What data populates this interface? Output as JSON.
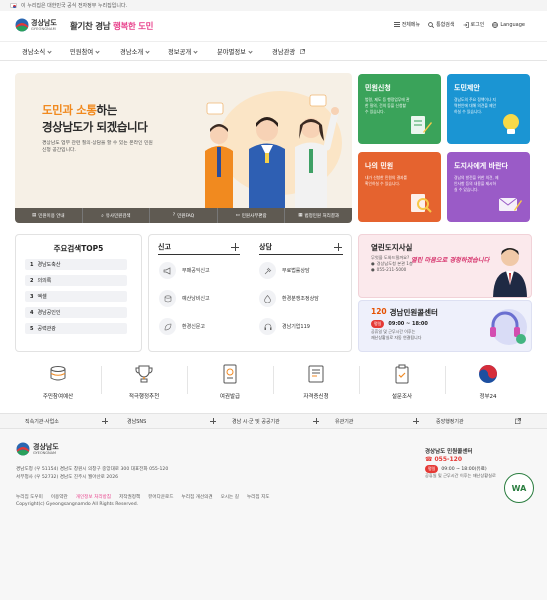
{
  "topbar": {
    "notice": "이 누리집은 대한민국 공식 전자정부 누리집입니다."
  },
  "header": {
    "logo_ko": "경상남도",
    "logo_en": "GYEONGNAM",
    "slogan_a": "활기찬 경남",
    "slogan_b": "행복한 도민",
    "links": {
      "all_menu": "전체메뉴",
      "search": "통합검색",
      "login": "로그인",
      "language": "Language"
    }
  },
  "nav": [
    "경남소식",
    "민원참여",
    "경남소개",
    "정보공개",
    "분야별정보",
    "경남관광"
  ],
  "hero": {
    "title_hl": "도민과 소통",
    "title_rest": "하는",
    "title2": "경상남도가 되겠습니다",
    "desc": "경상남도 업무 관련 질의·상담을 할 수 있는 온라인 민원신청 공간입니다.",
    "bar": [
      "민원이용 안내",
      "유사민원검색",
      "민원FAQ",
      "민원사무편람",
      "법정민원 처리결과"
    ]
  },
  "tiles": [
    {
      "title": "민원신청",
      "desc": "법령, 제도 등 행정업무에 관한 질의, 건의 등을 신청할 수 있습니다.",
      "color": "#3aa35a"
    },
    {
      "title": "도민제안",
      "desc": "경남도의 주요 정책이나 지역현안에 대해 의견을 제안하실 수 있습니다.",
      "color": "#1b95d3"
    },
    {
      "title": "나의 민원",
      "desc": "내가 신청한 민원의 결과를 확인하실 수 있습니다.",
      "color": "#e5632f"
    },
    {
      "title": "도지사에게 바란다",
      "desc": "경남의 발전을 위한 의견, 제안사항 등의 내용을 제시하실 수 있습니다.",
      "color": "#9a5bc7"
    }
  ],
  "keywords": {
    "title": "주요검색TOP5",
    "items": [
      {
        "rank": "1",
        "text": "경남도축산"
      },
      {
        "rank": "2",
        "text": "의의록"
      },
      {
        "rank": "3",
        "text": "엑셀"
      },
      {
        "rank": "4",
        "text": "경남공인인"
      },
      {
        "rank": "5",
        "text": "공력관광"
      }
    ]
  },
  "report": {
    "title": "신고",
    "items": [
      "부패공익신고",
      "예산낭비신고",
      "환경신문고"
    ]
  },
  "consult": {
    "title": "상담",
    "items": [
      "무료법률상담",
      "환경분쟁조정상담",
      "경남기업119"
    ]
  },
  "governor": {
    "title": "열린도지사실",
    "sub1": "무엇을 도와드릴까요?",
    "sub2": "경상남도청 본관 1층",
    "phone": "055-211-5000",
    "slogan": "열린 마음으로 경청하겠습니다"
  },
  "callcenter": {
    "title_num": "120",
    "title": "경남민원콜센터",
    "badge": "평일",
    "hours": "09:00 ~ 18:00",
    "note1": "공휴일 및 근무시간 이후는",
    "note2": "재난상황실로 자동 연결됩니다"
  },
  "quick": [
    "주민참여예산",
    "적극행정추천",
    "여권발급",
    "자격증신청",
    "설문조사",
    "정부24"
  ],
  "link_bar": [
    "직속기관·사업소",
    "경남SNS",
    "경남 시·군 및 공공기관",
    "유관기관",
    "중앙행정기관"
  ],
  "footer": {
    "addr1": "경남도청 (우 51154) 경남도 창원시 의창구 중앙대로 300 대표전화 055-120",
    "addr2": "서부청사 (우 52732) 경남도 진주시 월아산로 2026",
    "cc_title": "경상남도 민원콜센터",
    "cc_phone": "055-120",
    "cc_badge": "평일",
    "cc_hours": "09:00 ~ 18:00(유료)",
    "cc_note": "공휴일 및 근무시간 이후는 재난상황실로",
    "links": [
      "누리집 도우미",
      "이용약관",
      "개인정보 처리방침",
      "저작권정책",
      "뷰어다운로드",
      "누리집 개선의견",
      "오시는 길",
      "누리집 지도"
    ],
    "copyright": "Copyright(c) Gyeongsangnamdo All Rights Reserved.",
    "wa_badge": "WA",
    "colors": {
      "privacy": "#e8428c"
    }
  }
}
